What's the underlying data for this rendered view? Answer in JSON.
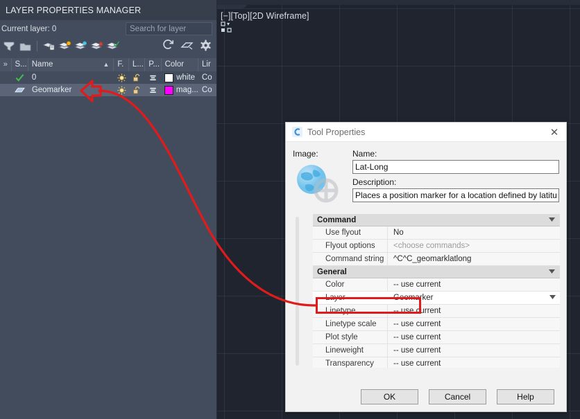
{
  "canvas": {
    "viewport_label": "[−][Top][2D Wireframe]",
    "background_color": "#1f242e",
    "grid_color": "#5a6578"
  },
  "layer_palette": {
    "title": "LAYER PROPERTIES MANAGER",
    "current_layer_label": "Current layer: 0",
    "search": {
      "placeholder": "Search for layer",
      "value": ""
    },
    "toolbar_icons": [
      "new-property-filter-icon",
      "new-group-filter-icon",
      "layer-states-manager-icon",
      "new-layer-icon",
      "new-layer-vp-frozen-icon",
      "delete-layer-icon",
      "set-current-icon",
      "refresh-icon",
      "layer-isolate-icon",
      "settings-gear-icon"
    ],
    "columns": [
      {
        "key": "expand",
        "label": "»"
      },
      {
        "key": "status",
        "label": "S..."
      },
      {
        "key": "name",
        "label": "Name"
      },
      {
        "key": "freeze",
        "label": "F."
      },
      {
        "key": "lock",
        "label": "L..."
      },
      {
        "key": "plot",
        "label": "P..."
      },
      {
        "key": "color",
        "label": "Color"
      },
      {
        "key": "linetype",
        "label": "Lir"
      }
    ],
    "sort_indicator": "▲",
    "rows": [
      {
        "status_icon": "green-check-icon",
        "name": "0",
        "freeze_icon": "sun-icon",
        "lock_icon": "unlocked-padlock-icon",
        "plot_icon": "plotter-icon",
        "color_swatch": "#ffffff",
        "color": "white",
        "linetype": "Co",
        "selected": false
      },
      {
        "status_icon": "layer-sheet-icon",
        "name": "Geomarker",
        "freeze_icon": "sun-icon",
        "lock_icon": "unlocked-padlock-icon",
        "plot_icon": "plotter-icon",
        "color_swatch": "#ff00ff",
        "color": "mag...",
        "linetype": "Co",
        "selected": true
      }
    ]
  },
  "dialog": {
    "title": "Tool Properties",
    "app_icon": "autocad-c-icon",
    "close_icon": "close-icon",
    "image_label": "Image:",
    "image_icon": "globe-geomarker-icon",
    "name_label": "Name:",
    "name_value": "Lat-Long",
    "description_label": "Description:",
    "description_value": "Places a position marker for a location defined by latitude and lon",
    "sections": [
      {
        "title": "Command",
        "caret": "caret-down-icon",
        "rows": [
          {
            "name": "Use flyout",
            "value": "No",
            "dim": false,
            "active": false,
            "dropdown": false
          },
          {
            "name": "Flyout options",
            "value": "<choose commands>",
            "dim": true,
            "active": false,
            "dropdown": false
          },
          {
            "name": "Command string",
            "value": "^C^C_geomarklatlong",
            "dim": false,
            "active": false,
            "dropdown": false
          }
        ]
      },
      {
        "title": "General",
        "caret": "caret-down-icon",
        "rows": [
          {
            "name": "Color",
            "value": "-- use current",
            "dim": false,
            "active": false,
            "dropdown": false
          },
          {
            "name": "Layer",
            "value": "Geomarker",
            "dim": false,
            "active": true,
            "dropdown": true
          },
          {
            "name": "Linetype",
            "value": "-- use current",
            "dim": false,
            "active": false,
            "dropdown": false
          },
          {
            "name": "Linetype scale",
            "value": "-- use current",
            "dim": false,
            "active": false,
            "dropdown": false
          },
          {
            "name": "Plot style",
            "value": "-- use current",
            "dim": false,
            "active": false,
            "dropdown": false
          },
          {
            "name": "Lineweight",
            "value": "-- use current",
            "dim": false,
            "active": false,
            "dropdown": false
          },
          {
            "name": "Transparency",
            "value": "-- use current",
            "dim": false,
            "active": false,
            "dropdown": false
          }
        ]
      }
    ],
    "buttons": [
      {
        "label": "OK"
      },
      {
        "label": "Cancel"
      },
      {
        "label": "Help"
      }
    ]
  },
  "annotation": {
    "color": "#e01b1b",
    "arrow_name": "callout-arrow-to-geomarker-layer",
    "curve_name": "callout-curve",
    "highlight_name": "layer-row-highlight-box"
  }
}
